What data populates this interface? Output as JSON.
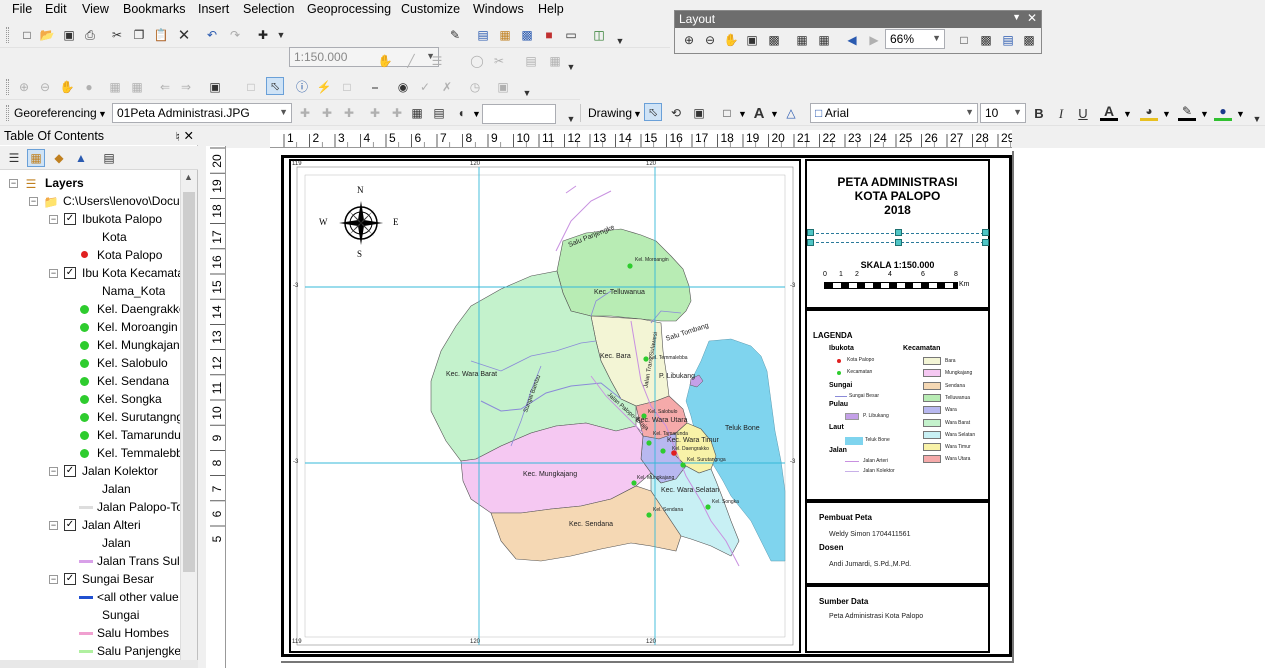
{
  "menu": [
    "File",
    "Edit",
    "View",
    "Bookmarks",
    "Insert",
    "Selection",
    "Geoprocessing",
    "Customize",
    "Windows",
    "Help"
  ],
  "toolbar": {
    "scale": "1:150.000",
    "georef_label": "Georeferencing",
    "georef_layer": "01Peta Administrasi.JPG",
    "drawing_label": "Drawing",
    "font_name": "Arial",
    "font_size": "10",
    "bold": "B",
    "italic": "I",
    "underline": "U",
    "text_a": "A"
  },
  "layout_toolbar": {
    "title": "Layout",
    "zoom": "66%"
  },
  "toc": {
    "title": "Table Of Contents",
    "items": [
      {
        "label": "Layers",
        "bold": true
      },
      {
        "label": "C:\\Users\\lenovo\\Docu"
      },
      {
        "label": "Ibukota Palopo"
      },
      {
        "label": "Kota"
      },
      {
        "label": "Kota Palopo"
      },
      {
        "label": "Ibu Kota Kecamata"
      },
      {
        "label": "Nama_Kota"
      },
      {
        "label": "Kel. Daengrakko"
      },
      {
        "label": "Kel. Moroangin"
      },
      {
        "label": "Kel. Mungkajan"
      },
      {
        "label": "Kel. Salobulo"
      },
      {
        "label": "Kel. Sendana"
      },
      {
        "label": "Kel. Songka"
      },
      {
        "label": "Kel. Surutangng"
      },
      {
        "label": "Kel. Tamarundu"
      },
      {
        "label": "Kel. Temmalebb"
      },
      {
        "label": "Jalan Kolektor"
      },
      {
        "label": "Jalan"
      },
      {
        "label": "Jalan Palopo-To"
      },
      {
        "label": "Jalan Alteri"
      },
      {
        "label": "Jalan"
      },
      {
        "label": "Jalan Trans Sula"
      },
      {
        "label": "Sungai Besar"
      },
      {
        "label": "<all other value"
      },
      {
        "label": "Sungai"
      },
      {
        "label": "Salu Hombes"
      },
      {
        "label": "Salu Panjengke"
      }
    ]
  },
  "ruler_h": [
    "1",
    "2",
    "3",
    "4",
    "5",
    "6",
    "7",
    "8",
    "9",
    "10",
    "11",
    "12",
    "13",
    "14",
    "15",
    "16",
    "17",
    "18",
    "19",
    "20",
    "21",
    "22",
    "23",
    "24",
    "25",
    "26",
    "27",
    "28",
    "29"
  ],
  "ruler_v": [
    "20",
    "19",
    "18",
    "17",
    "16",
    "15",
    "14",
    "13",
    "12",
    "11",
    "10",
    "9",
    "8",
    "7",
    "6",
    "5"
  ],
  "map": {
    "grid_top": [
      "119",
      "120",
      "120"
    ],
    "grid_bottom": [
      "119",
      "120",
      "120"
    ],
    "grid_left": [
      "-3",
      "-3"
    ],
    "grid_right": [
      "-3",
      "-3"
    ],
    "compass": {
      "n": "N",
      "s": "S",
      "e": "E",
      "w": "W"
    },
    "labels": {
      "telluwanua": "Kec. Telluwanua",
      "bara": "Kec. Bara",
      "wara_barat": "Kec. Wara Barat",
      "mungkajang": "Kec. Mungkajang",
      "sendana": "Kec. Sendana",
      "wara_selatan": "Kec. Wara Selatan",
      "wara_timur": "Kec. Wara Timur",
      "wara_utara": "Kec. Wara Utara",
      "teluk_bone": "Teluk Bone",
      "p_libukang": "P. Libukang",
      "salu_panjengke": "Salu Panjengke",
      "salu_tombang": "Salu Tombang",
      "sungai_bambu": "Sungai Bambu",
      "jalan_trans": "Jalan Trans Sulawesi",
      "jalan_palopo": "Jalan Palopo-Toraja",
      "kel_moroangin": "Kel. Moroangin",
      "kel_temmalebba": "Kel. Temmalebba",
      "kel_salobulo": "Kel. Salobulo",
      "kel_tamarunda": "Kel. Tamarunda",
      "kel_daengrakko": "Kel. Daengrakko",
      "kel_surutangnga": "Kel. Surutangnga",
      "kel_mungkajang": "Kel. Mungkajang",
      "kel_songka": "Kel. Songka",
      "kel_sendana": "Kel. Sendana"
    }
  },
  "panel": {
    "title1": "PETA ADMINISTRASI",
    "title2": "KOTA PALOPO",
    "title3": "2018",
    "scale_label": "SKALA 1:150.000",
    "scale_ticks": [
      "0",
      "1",
      "2",
      "4",
      "6",
      "8"
    ],
    "scale_unit": "Km",
    "legend_title": "LAGENDA",
    "ibukota": "Ibukota",
    "kota_palopo": "Kota Palopo",
    "kecamatan_pt": "Kecamatan",
    "sungai": "Sungai",
    "sungai_besar": "Sungai Besar",
    "pulau": "Pulau",
    "p_libukang": "P. Libukang",
    "laut": "Laut",
    "teluk_bone": "Teluk Bone",
    "jalan": "Jalan",
    "jalan_arteri": "Jalan Arteri",
    "jalan_kolektor": "Jalan Kolektor",
    "kecamatan_head": "Kecamatan",
    "kecamatan": [
      {
        "name": "Bara",
        "color": "#f3f5d5"
      },
      {
        "name": "Mungkajang",
        "color": "#f5c8f2"
      },
      {
        "name": "Sendana",
        "color": "#f5d8b4"
      },
      {
        "name": "Telluwanua",
        "color": "#b8ecb4"
      },
      {
        "name": "Wara",
        "color": "#b8b8f0"
      },
      {
        "name": "Wara Barat",
        "color": "#c4f2cc"
      },
      {
        "name": "Wara Selatan",
        "color": "#c8f0f4"
      },
      {
        "name": "Wara Timur",
        "color": "#f8f2a8"
      },
      {
        "name": "Wara Utara",
        "color": "#f5aaaa"
      }
    ],
    "pembuat_label": "Pembuat Peta",
    "pembuat_name": "Weldy Simon  1704411561",
    "dosen_label": "Dosen",
    "dosen_name": "Andi Jumardi, S.Pd.,M.Pd.",
    "sumber_label": "Sumber Data",
    "sumber_name": "Peta Administrasi Kota Palopo"
  },
  "colors": {
    "sea": "#7fd4ee",
    "dot_red": "#e02020",
    "dot_green": "#2ecc2e",
    "grid": "#34b8d8",
    "river": "#8a8ad8",
    "road": "#c890e0"
  }
}
